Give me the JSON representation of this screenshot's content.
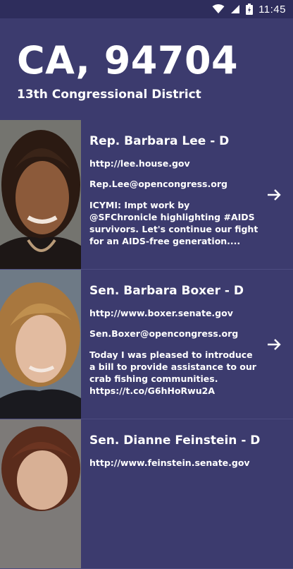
{
  "status_bar": {
    "time": "11:45"
  },
  "header": {
    "location": "CA, 94704",
    "district": "13th Congressional District"
  },
  "representatives": [
    {
      "name": "Rep. Barbara Lee - D",
      "website": "http://lee.house.gov",
      "email": "Rep.Lee@opencongress.org",
      "tweet": "ICYMI: Impt work by @SFChronicle highlighting #AIDS survivors. Let's continue our fight for an AIDS-free generation...."
    },
    {
      "name": "Sen. Barbara Boxer - D",
      "website": "http://www.boxer.senate.gov",
      "email": "Sen.Boxer@opencongress.org",
      "tweet": "Today I was pleased to introduce a bill to provide assistance to our crab fishing communities. https://t.co/G6hHoRwu2A"
    },
    {
      "name": "Sen. Dianne Feinstein - D",
      "website": "http://www.feinstein.senate.gov"
    }
  ],
  "colors": {
    "background": "#3c3b6e",
    "status_bar": "#2e2d5c",
    "text": "#ffffff"
  }
}
